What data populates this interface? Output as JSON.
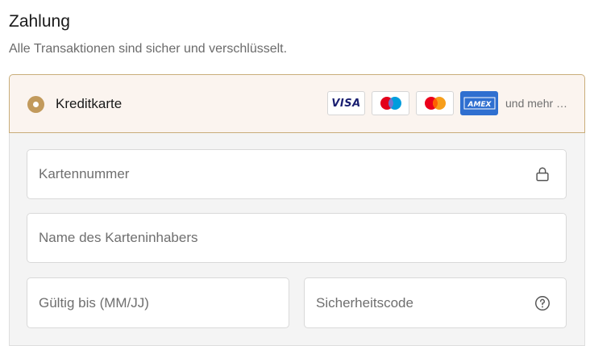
{
  "header": {
    "title": "Zahlung",
    "subtitle": "Alle Transaktionen sind sicher und verschlüsselt."
  },
  "payment_method": {
    "label": "Kreditkarte",
    "selected": true,
    "card_brands": [
      {
        "name": "VISA",
        "icon": "visa-logo"
      },
      {
        "name": "Maestro",
        "icon": "maestro-logo"
      },
      {
        "name": "Mastercard",
        "icon": "mastercard-logo"
      },
      {
        "name": "AMEX",
        "icon": "amex-logo"
      }
    ],
    "more_text": "und mehr …"
  },
  "form": {
    "card_number": {
      "placeholder": "Kartennummer",
      "value": "",
      "icon": "lock-icon"
    },
    "cardholder_name": {
      "placeholder": "Name des Karteninhabers",
      "value": ""
    },
    "expiry": {
      "placeholder": "Gültig bis (MM/JJ)",
      "value": ""
    },
    "security_code": {
      "placeholder": "Sicherheitscode",
      "value": "",
      "icon": "help-icon"
    }
  },
  "colors": {
    "accent": "#c29a5c",
    "method_bg": "#fbf4ef",
    "form_bg": "#f4f4f4",
    "amex_blue": "#2f6fd0",
    "visa_navy": "#1a1f71"
  }
}
